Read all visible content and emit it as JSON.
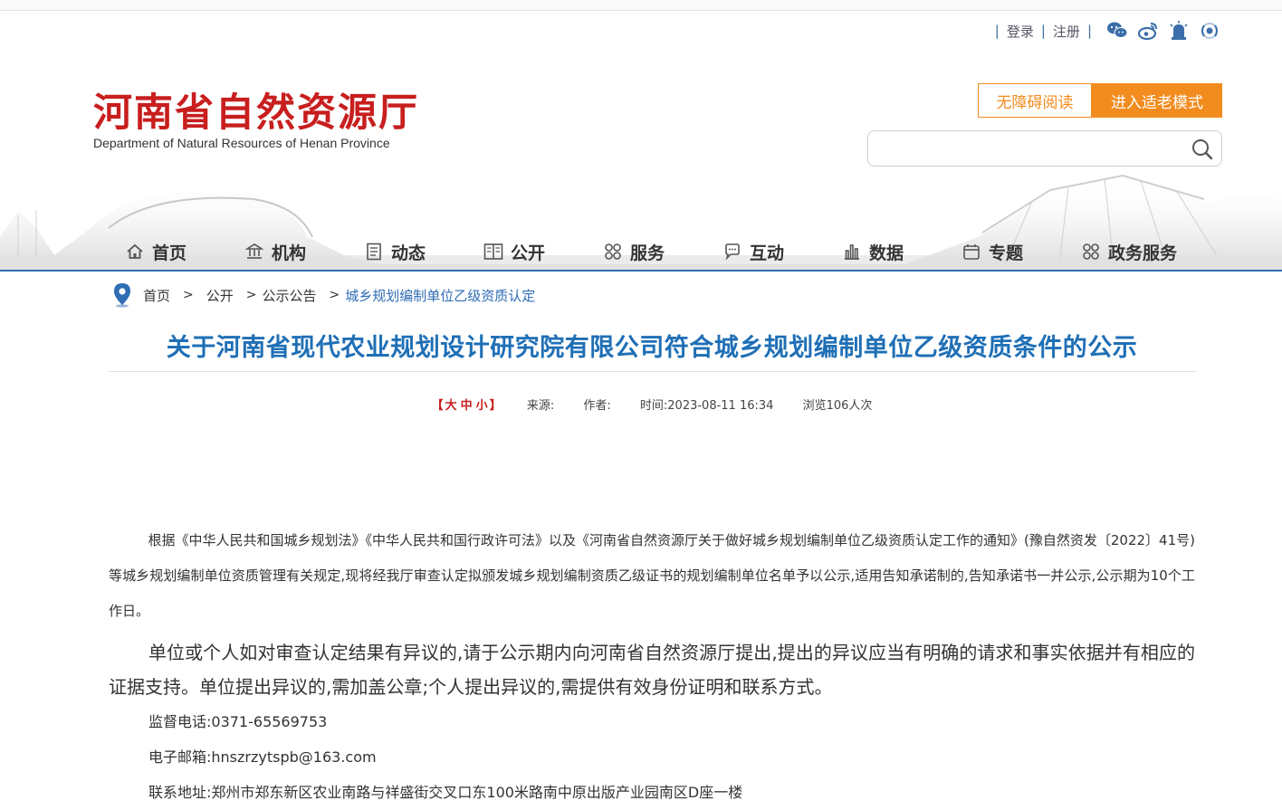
{
  "utility": {
    "login": "登录",
    "register": "注册",
    "sep": "|"
  },
  "icons": [
    "wechat-icon",
    "weibo-icon",
    "alert-icon",
    "broadcast-icon",
    "search-icon",
    "home-icon",
    "institution-icon",
    "document-icon",
    "book-icon",
    "grid-icon",
    "chat-icon",
    "bar-chart-icon",
    "calendar-icon",
    "location-pin-icon"
  ],
  "logo": {
    "cn": "河南省自然资源厅",
    "en": "Department of Natural Resources of Henan Province"
  },
  "modes": {
    "accessibility": "无障碍阅读",
    "elder": "进入适老模式"
  },
  "search": {
    "placeholder": ""
  },
  "nav": [
    {
      "label": "首页",
      "icon": "home-icon"
    },
    {
      "label": "机构",
      "icon": "institution-icon"
    },
    {
      "label": "动态",
      "icon": "document-icon"
    },
    {
      "label": "公开",
      "icon": "book-icon"
    },
    {
      "label": "服务",
      "icon": "grid-icon"
    },
    {
      "label": "互动",
      "icon": "chat-icon"
    },
    {
      "label": "数据",
      "icon": "bar-chart-icon"
    },
    {
      "label": "专题",
      "icon": "calendar-icon"
    },
    {
      "label": "政务服务",
      "icon": "grid-icon"
    }
  ],
  "breadcrumb": {
    "home": "首页",
    "sep": ">",
    "level1": "公开",
    "level2": "公示公告",
    "current": "城乡规划编制单位乙级资质认定"
  },
  "article": {
    "title": "关于河南省现代农业规划设计研究院有限公司符合城乡规划编制单位乙级资质条件的公示",
    "meta": {
      "size_open": "【",
      "size_large": "大",
      "size_medium": "中",
      "size_small": "小",
      "size_close": "】",
      "source": "来源:",
      "author": "作者:",
      "time": "时间:2023-08-11 16:34",
      "views": "浏览106人次"
    },
    "paragraph1": "根据《中华人民共和国城乡规划法》《中华人民共和国行政许可法》以及《河南省自然资源厅关于做好城乡规划编制单位乙级资质认定工作的通知》(豫自然资发〔2022〕41号)等城乡规划编制单位资质管理有关规定,现将经我厅审查认定拟颁发城乡规划编制资质乙级证书的规划编制单位名单予以公示,适用告知承诺制的,告知承诺书一并公示,公示期为10个工作日。",
    "paragraph2": "单位或个人如对审查认定结果有异议的,请于公示期内向河南省自然资源厅提出,提出的异议应当有明确的请求和事实依据并有相应的证据支持。单位提出异议的,需加盖公章;个人提出异议的,需提供有效身份证明和联系方式。",
    "phone": "监督电话:0371-65569753",
    "email": "电子邮箱:hnszrzytspb@163.com",
    "address": "联系地址:郑州市郑东新区农业南路与祥盛街交叉口东100米路南中原出版产业园南区D座一楼"
  },
  "colors": {
    "brand_red": "#c81e1e",
    "link_blue": "#2f6db5",
    "title_blue": "#1f6fb6",
    "orange": "#f28c1f"
  }
}
